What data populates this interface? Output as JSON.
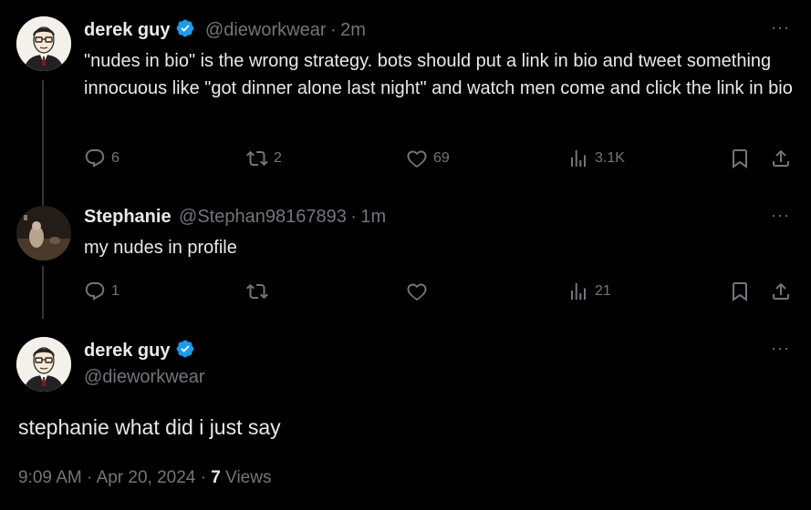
{
  "tweet1": {
    "name": "derek guy",
    "handle": "@dieworkwear",
    "time": "2m",
    "text": "\"nudes in bio\" is the wrong strategy. bots should put a link in bio and tweet something innocuous like \"got dinner alone last night\" and watch men come and click the link in bio",
    "replies": "6",
    "reposts": "2",
    "likes": "69",
    "views": "3.1K"
  },
  "tweet2": {
    "name": "Stephanie",
    "handle": "@Stephan98167893",
    "time": "1m",
    "text": "my nudes in profile",
    "replies": "1",
    "views": "21"
  },
  "main_tweet": {
    "name": "derek guy",
    "handle": "@dieworkwear",
    "text": "stephanie what did i just say",
    "time": "9:09 AM",
    "date": "Apr 20, 2024",
    "views_count": "7",
    "views_label": "Views"
  },
  "separator": "·",
  "more_glyph": "···",
  "colors": {
    "background": "#000000",
    "text": "#e7e9ea",
    "muted": "#71767b",
    "verified": "#1d9bf0"
  },
  "icons": [
    "verified-badge-icon",
    "reply-icon",
    "repost-icon",
    "like-icon",
    "views-icon",
    "bookmark-icon",
    "share-icon",
    "more-icon"
  ]
}
